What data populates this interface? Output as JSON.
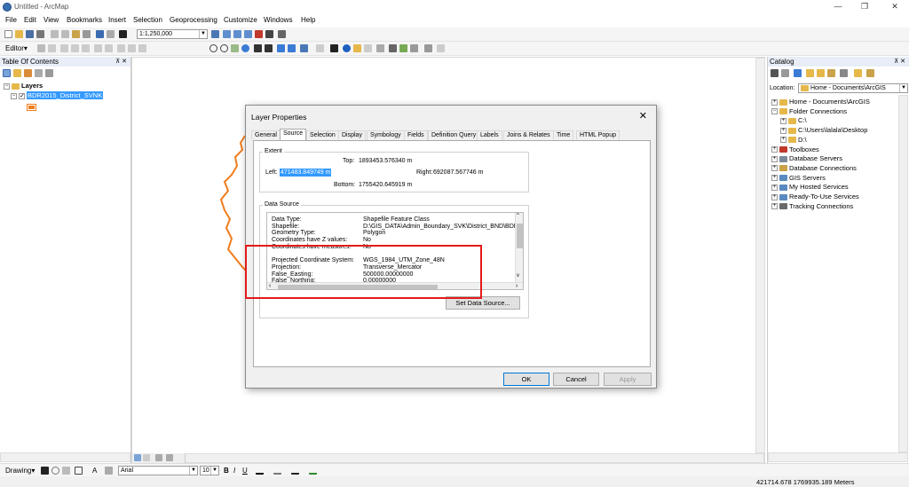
{
  "window": {
    "title": "Untitled - ArcMap",
    "minimize": "—",
    "maximize": "❐",
    "close": "✕"
  },
  "menu": [
    "File",
    "Edit",
    "View",
    "Bookmarks",
    "Insert",
    "Selection",
    "Geoprocessing",
    "Customize",
    "Windows",
    "Help"
  ],
  "toolbar": {
    "scale": "1:1,250,000",
    "editor_label": "Editor▾"
  },
  "toc": {
    "title": "Table Of Contents",
    "pin": "⊼ ✕",
    "root": "Layers",
    "layer": "BDR2015_District_SVNK",
    "symbol_color": "#f07d1c"
  },
  "catalog": {
    "title": "Catalog",
    "pin": "⊼ ✕",
    "location_label": "Location:",
    "location_value": "Home - Documents\\ArcGIS",
    "items": [
      {
        "label": "Home - Documents\\ArcGIS",
        "indent": 0
      },
      {
        "label": "Folder Connections",
        "indent": 0
      },
      {
        "label": "C:\\",
        "indent": 1
      },
      {
        "label": "C:\\Users\\lalala\\Desktop",
        "indent": 1
      },
      {
        "label": "D:\\",
        "indent": 1
      },
      {
        "label": "Toolboxes",
        "indent": 0
      },
      {
        "label": "Database Servers",
        "indent": 0
      },
      {
        "label": "Database Connections",
        "indent": 0
      },
      {
        "label": "GIS Servers",
        "indent": 0
      },
      {
        "label": "My Hosted Services",
        "indent": 0
      },
      {
        "label": "Ready-To-Use Services",
        "indent": 0
      },
      {
        "label": "Tracking Connections",
        "indent": 0
      }
    ]
  },
  "dialog": {
    "title": "Layer Properties",
    "close": "✕",
    "tabs": [
      "General",
      "Source",
      "Selection",
      "Display",
      "Symbology",
      "Fields",
      "Definition Query",
      "Labels",
      "Joins & Relates",
      "Time",
      "HTML Popup"
    ],
    "selected_tab": "Source",
    "extent": {
      "label": "Extent",
      "top_label": "Top:",
      "top": "1893453.576340 m",
      "left_label": "Left:",
      "left": "471483.849749 m",
      "right_label": "Right:",
      "right": "692087.567746 m",
      "bottom_label": "Bottom:",
      "bottom": "1755420.645919 m"
    },
    "data_source": {
      "label": "Data Source",
      "rows": [
        {
          "k": "Data Type:",
          "v": "Shapefile Feature Class"
        },
        {
          "k": "Shapefile:",
          "v": "D:\\GIS_DATA\\Admin_Boundary_SVK\\District_BND\\BDR"
        },
        {
          "k": "Geometry Type:",
          "v": "Polygon"
        },
        {
          "k": "Coordinates have Z values:",
          "v": "No"
        },
        {
          "k": "Coordinates have measures:",
          "v": "No"
        },
        {
          "k": "",
          "v": ""
        },
        {
          "k": "Projected Coordinate System:",
          "v": "WGS_1984_UTM_Zone_48N"
        },
        {
          "k": "Projection:",
          "v": "Transverse_Mercator"
        },
        {
          "k": "False_Easting:",
          "v": "500000.00000000"
        },
        {
          "k": "False_Northing:",
          "v": "0.00000000"
        }
      ]
    },
    "set_data_source": "Set Data Source...",
    "ok": "OK",
    "cancel": "Cancel",
    "apply": "Apply"
  },
  "drawing_toolbar": {
    "drawing_label": "Drawing▾",
    "font": "Arial",
    "size": "10",
    "bold": "B",
    "italic": "I",
    "underline": "U"
  },
  "status": {
    "coords": "421714.678  1769935.189 Meters"
  }
}
